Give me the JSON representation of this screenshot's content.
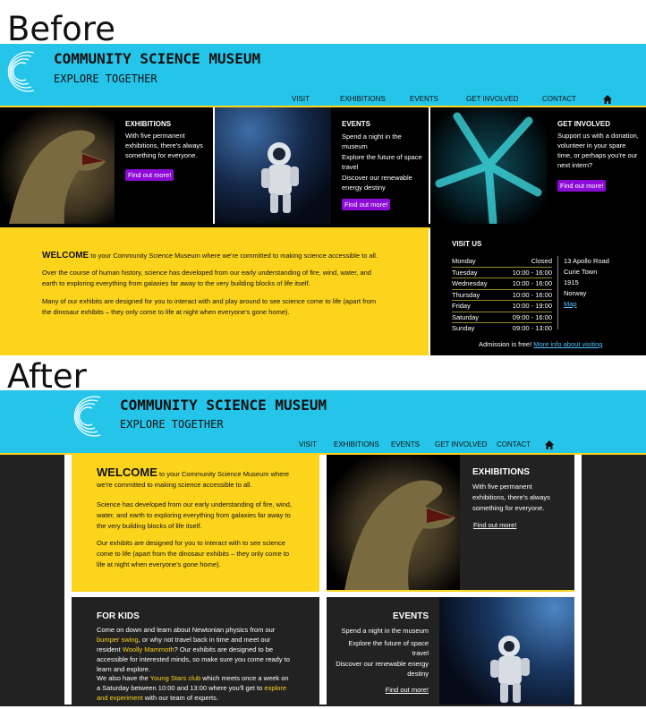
{
  "labels": {
    "before": "Before",
    "after": "After"
  },
  "site": {
    "title": "COMMUNITY SCIENCE MUSEUM",
    "subtitle": "EXPLORE TOGETHER"
  },
  "nav": [
    "VISIT",
    "EXHIBITIONS",
    "EVENTS",
    "GET INVOLVED",
    "CONTACT"
  ],
  "home_icon": "home-icon",
  "colors": {
    "header": "#25c5ea",
    "yellow": "#fcd41c",
    "purple": "#8d0bd6",
    "dark": "#222222",
    "link": "#53c1ff"
  },
  "before": {
    "exhibitions": {
      "title": "EXHIBITIONS",
      "text": "With five permanent exhibitions, there's always something for everyone.",
      "button": "Find out more!"
    },
    "events": {
      "title": "EVENTS",
      "items": [
        "Spend a night in the museum",
        "Explore the future of space travel",
        "Discover our renewable energy destiny"
      ],
      "button": "Find out more!"
    },
    "involved": {
      "title": "GET INVOLVED",
      "text": "Support us with a donation, volunteer in your spare time, or perhaps you're our next intern?",
      "button": "Find out more!"
    },
    "welcome": {
      "heading": "WELCOME",
      "lead": " to your Community Science Museum where we're committed to making science accessible to all.",
      "p1": "Over the course of human history, science has developed from our early understanding of fire, wind, water, and earth to exploring everything from galaxies far away to the very building blocks of life itself.",
      "p2": "Many of our exhibits are designed for you to interact with and play around to see science come to life (apart from the dinosaur exhibits – they only come to life at night when everyone's gone home)."
    },
    "visit": {
      "title": "VISIT US",
      "hours": [
        {
          "day": "Monday",
          "time": "Closed"
        },
        {
          "day": "Tuesday",
          "time": "10:00 - 16:00"
        },
        {
          "day": "Wednesday",
          "time": "10:00 - 16:00"
        },
        {
          "day": "Thursday",
          "time": "10:00 - 16:00"
        },
        {
          "day": "Friday",
          "time": "10:00 - 19:00"
        },
        {
          "day": "Saturday",
          "time": "09:00 - 16:00"
        },
        {
          "day": "Sunday",
          "time": "09:00 - 13:00"
        }
      ],
      "address": [
        "13 Apollo Road",
        "Curie Town",
        "1915",
        "Norway"
      ],
      "map_link": "Map",
      "admission": "Admission is free! ",
      "admission_link": "More info about visiting"
    }
  },
  "after": {
    "welcome": {
      "heading": "WELCOME",
      "lead": " to your Community Science Museum where we're committed to making science accessible to all.",
      "p1": "Science has developed from our early understanding of fire, wind, water, and earth to exploring everything from galaxies far away to the very building blocks of life itself.",
      "p2": "Our exhibits are designed for you to interact with to see science come to life (apart from the dinosaur exhibits – they only come to life at night when everyone's gone home)."
    },
    "exhibitions": {
      "title": "EXHIBITIONS",
      "text": "With five permanent exhibitions, there's always something for everyone.",
      "link": "Find out more!"
    },
    "kids": {
      "title": "FOR KIDS",
      "p1a": "Come on down and learn about Newtonian physics from our ",
      "p1b": "bumper swing",
      "p1c": ", or why not travel back in time and meet our resident ",
      "p1d": "Woolly Mammoth",
      "p1e": "? Our exhibits are designed to be accessible for interested minds, so make sure you come ready to learn and explore.",
      "p2a": "We also have the ",
      "p2b": "Young Stars club",
      "p2c": " which meets once a week on a Saturday between 10:00 and 13:00 where you'll get to ",
      "p2d": "explore and experiment",
      "p2e": " with our team of experts."
    },
    "events": {
      "title": "EVENTS",
      "items": [
        "Spend a night in the museum",
        "Explore the future of space travel",
        "Discover our renewable energy destiny"
      ],
      "link": "Find out more!"
    }
  }
}
